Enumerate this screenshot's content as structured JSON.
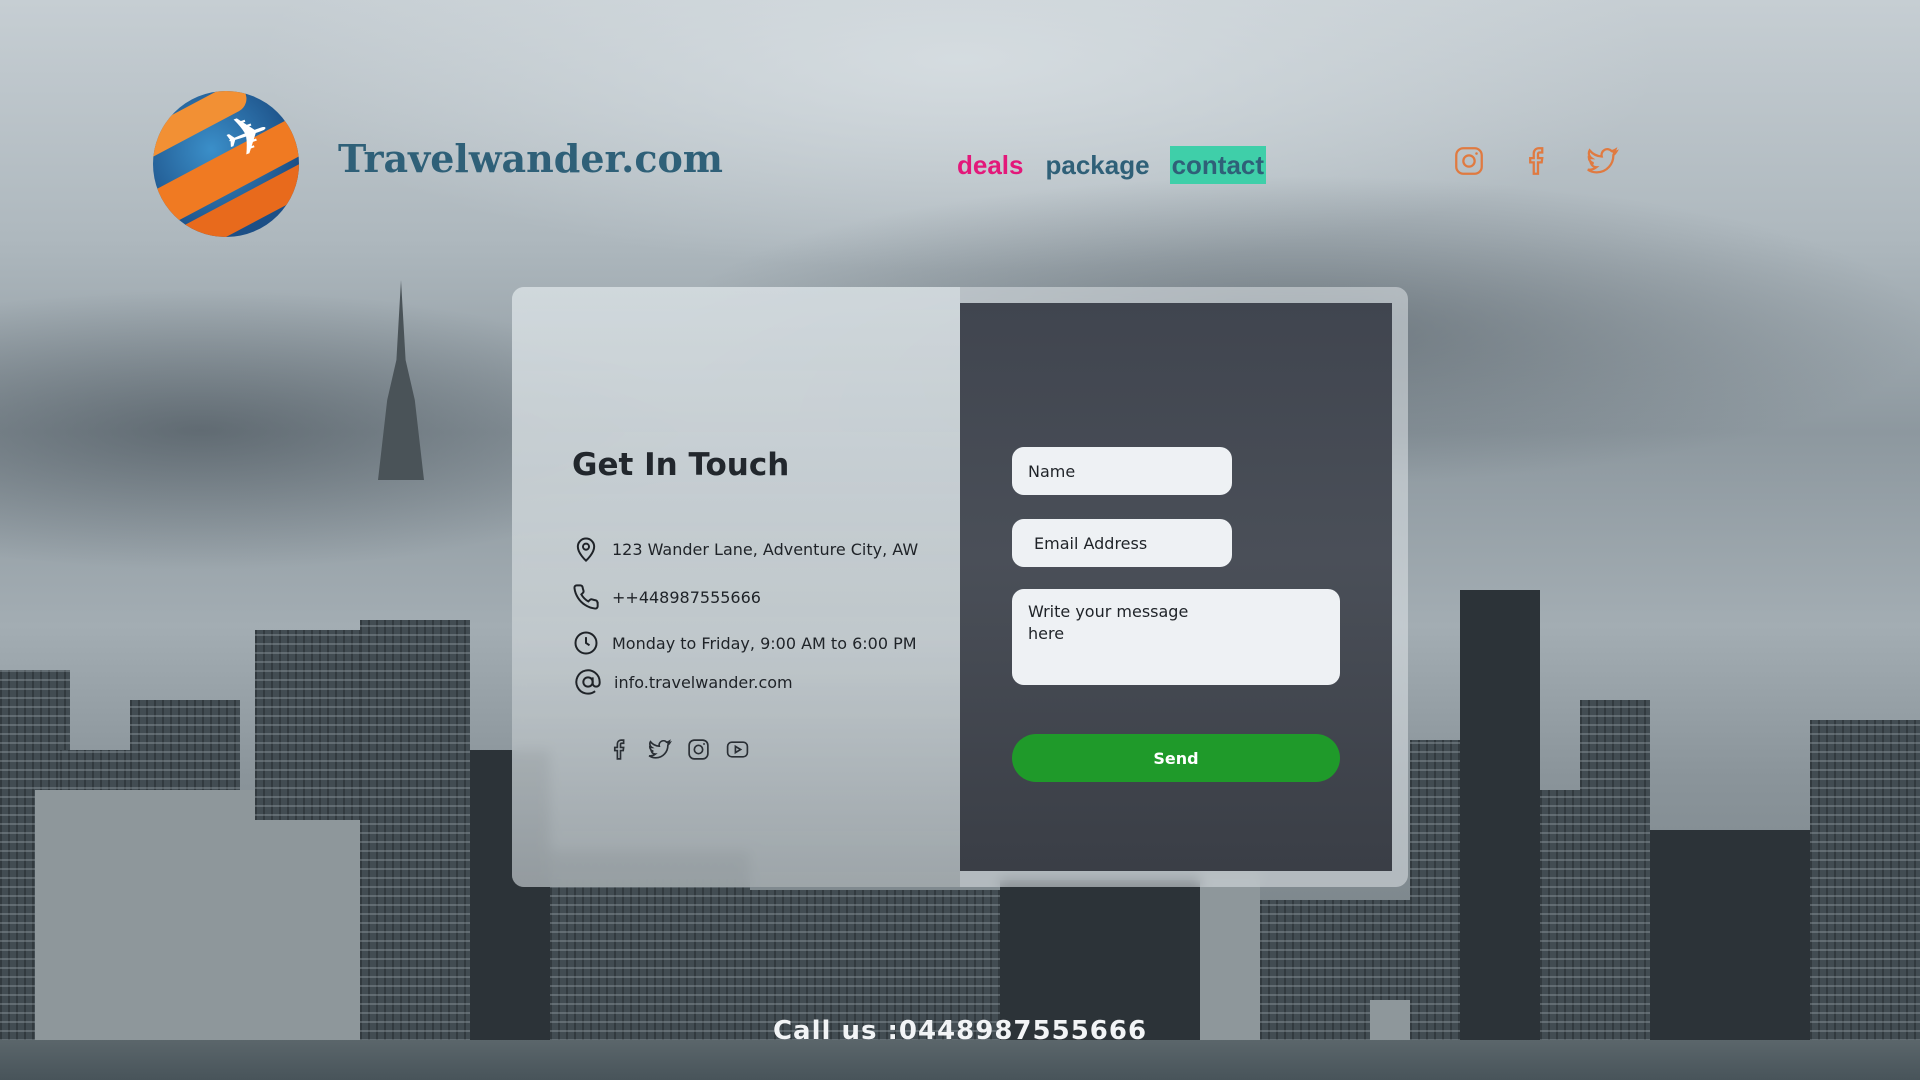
{
  "brand": {
    "name": "Travelwander.com",
    "logo_icon": "globe-plane-logo"
  },
  "nav": [
    {
      "label": "deals",
      "color": "#e3187a"
    },
    {
      "label": "package",
      "color": "#2f6078"
    },
    {
      "label": "contact",
      "color": "#2f6078",
      "highlight": "#3fcfa9"
    }
  ],
  "social_header": [
    "instagram-icon",
    "facebook-icon",
    "twitter-icon"
  ],
  "social_color": "#e07a40",
  "contact": {
    "title": "Get In Touch",
    "address": "123 Wander Lane, Adventure City, AW",
    "phone": "++448987555666",
    "hours": "Monday to Friday, 9:00 AM to 6:00 PM",
    "email": "info.travelwander.com",
    "social_icons": [
      "facebook-icon",
      "twitter-icon",
      "instagram-icon",
      "youtube-icon"
    ]
  },
  "form": {
    "name_placeholder": "Name",
    "email_placeholder": "Email Address",
    "message_placeholder": "Write your message here",
    "send_label": "Send",
    "send_color": "#1f9a2a"
  },
  "footer": {
    "call_us": "Call us :0448987555666"
  }
}
